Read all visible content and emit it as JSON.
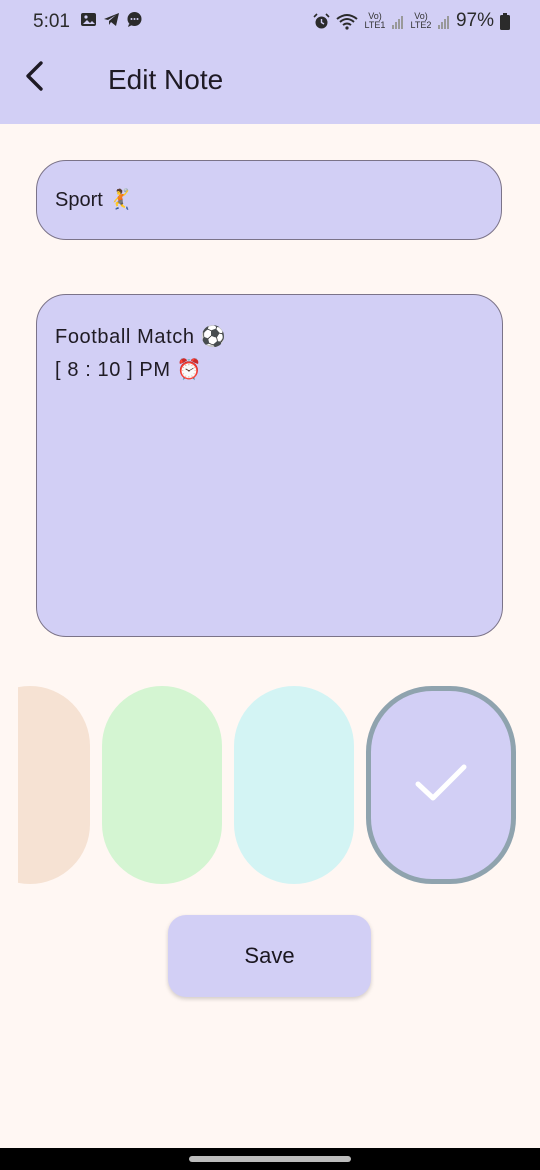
{
  "status_bar": {
    "time": "5:01",
    "lte1": "Vo) LTE1",
    "lte2": "Vo) LTE2",
    "battery": "97%",
    "icons": [
      "image-icon",
      "telegram-icon",
      "chat-icon",
      "alarm-icon",
      "wifi-icon",
      "signal-icon",
      "battery-icon"
    ]
  },
  "app_bar": {
    "title": "Edit Note",
    "back_icon": "back-arrow-icon"
  },
  "form": {
    "title_value": "Sport 🤾",
    "body_lines": [
      "Football Match ⚽",
      "[ 8 : 10 ] PM ⏰"
    ]
  },
  "colors": {
    "options": [
      {
        "name": "peach",
        "hex": "#F6E2D3",
        "selected": false
      },
      {
        "name": "green",
        "hex": "#D4F5D2",
        "selected": false
      },
      {
        "name": "cyan",
        "hex": "#D3F4F4",
        "selected": false
      },
      {
        "name": "lavender",
        "hex": "#D2CFF5",
        "selected": true
      }
    ],
    "selected_icon": "check-icon",
    "selected_border": "#8FA3AE",
    "header_bg": "#D2CFF5",
    "page_bg": "#FFF7F3"
  },
  "actions": {
    "save_label": "Save"
  }
}
